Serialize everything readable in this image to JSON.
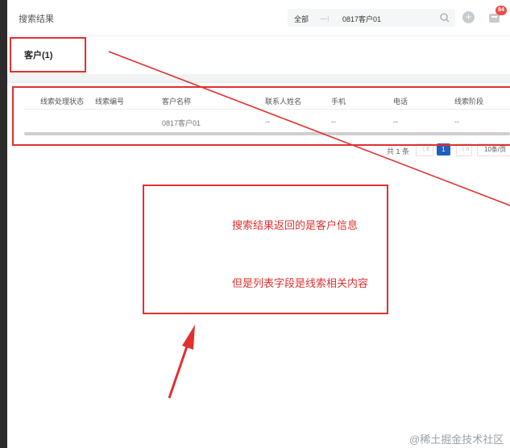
{
  "header": {
    "title": "搜索结果",
    "search": {
      "scope": "全部",
      "separator": "一!",
      "query": "0817客户01"
    },
    "notification_count": "84"
  },
  "tabs": [
    {
      "label": "客户(1)"
    }
  ],
  "table": {
    "columns": [
      "线索处理状态",
      "线索编号",
      "客户名称",
      "联系人姓名",
      "手机",
      "电话",
      "线索阶段"
    ],
    "rows": [
      {
        "status": "",
        "code": "",
        "customer": "0817客户01",
        "contact": "--",
        "mobile": "--",
        "phone": "--",
        "stage": "--"
      }
    ]
  },
  "pagination": {
    "total": "共 1 条",
    "prev": "〈 E",
    "current": "1",
    "next": "〈 n",
    "page_size": "10条/页"
  },
  "annotations": {
    "line1": "搜索结果返回的是客户信息",
    "line2": "但是列表字段是线索相关内容",
    "color": "#e03131"
  },
  "watermark": "@稀土掘金技术社区"
}
